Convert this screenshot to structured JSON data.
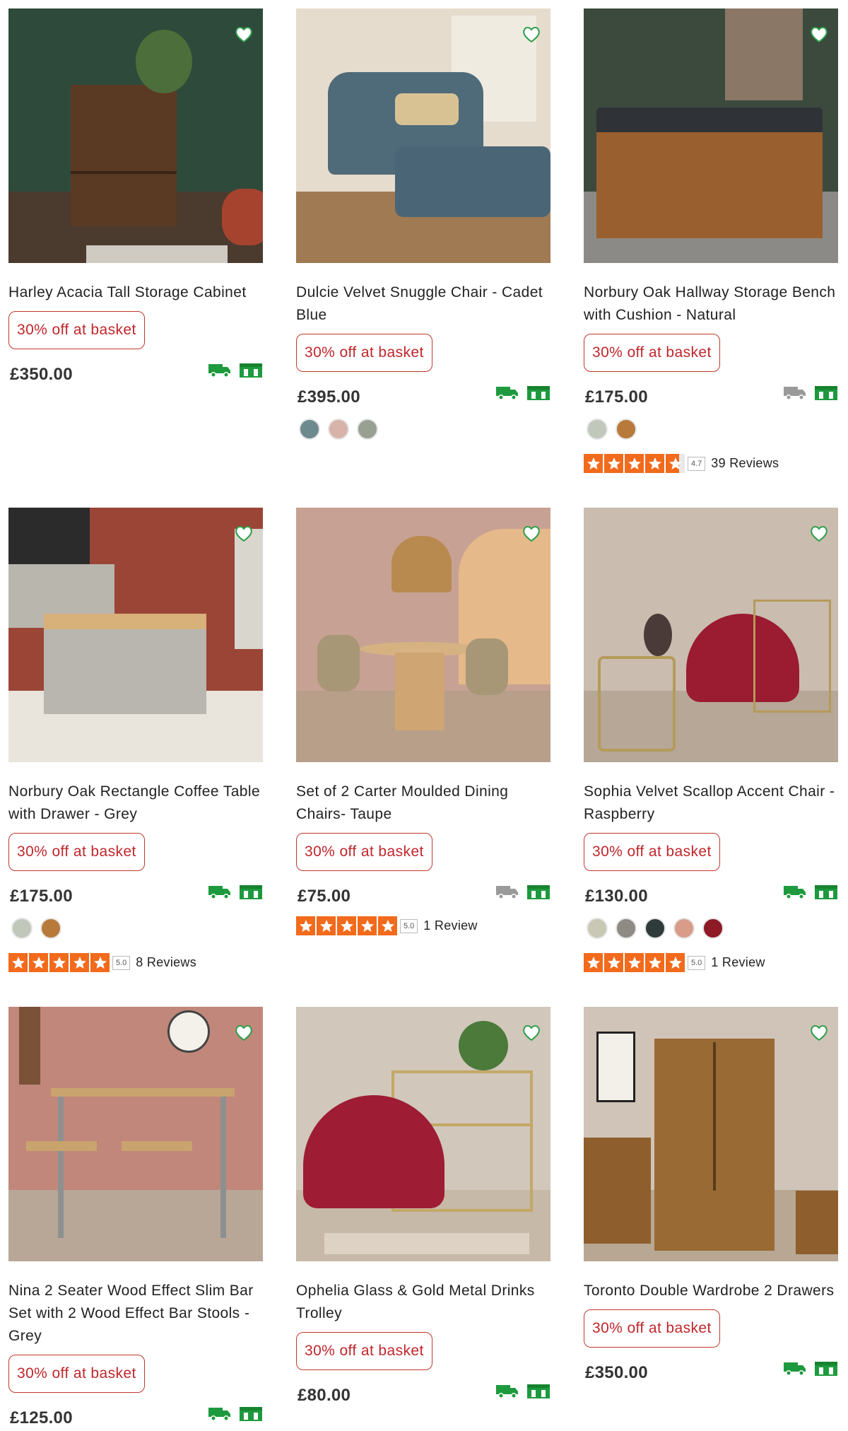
{
  "colors": {
    "offer": "#c0262b",
    "delivery": "#1e9a3e",
    "delivery_muted": "#9a9a9a",
    "star": "#f26a1b",
    "heart": "#2e9e4a"
  },
  "products": [
    {
      "title": "Harley Acacia Tall Storage Cabinet",
      "offer": "30% off at basket",
      "price": "£350.00",
      "delivery_available": true,
      "swatches": [],
      "rating": null
    },
    {
      "title": "Dulcie Velvet Snuggle Chair - Cadet Blue",
      "offer": "30% off at basket",
      "price": "£395.00",
      "delivery_available": true,
      "swatches": [
        "#6d8a8f",
        "#d8b3aa",
        "#98a092"
      ],
      "rating": null
    },
    {
      "title": "Norbury Oak Hallway Storage Bench with Cushion - Natural",
      "offer": "30% off at basket",
      "price": "£175.00",
      "delivery_available": false,
      "swatches": [
        "#bfc8ba",
        "#b87a3a"
      ],
      "rating": {
        "score": "4.7",
        "reviews": "39 Reviews",
        "stars": 4.7
      }
    },
    {
      "title": "Norbury Oak Rectangle Coffee Table with Drawer - Grey",
      "offer": "30% off at basket",
      "price": "£175.00",
      "delivery_available": true,
      "swatches": [
        "#bfc8ba",
        "#b87a3a"
      ],
      "rating": {
        "score": "5.0",
        "reviews": "8 Reviews",
        "stars": 5
      }
    },
    {
      "title": "Set of 2 Carter Moulded Dining Chairs- Taupe",
      "offer": "30% off at basket",
      "price": "£75.00",
      "delivery_available": false,
      "swatches": [],
      "rating": {
        "score": "5.0",
        "reviews": "1 Review",
        "stars": 5
      }
    },
    {
      "title": "Sophia Velvet Scallop Accent Chair - Raspberry",
      "offer": "30% off at basket",
      "price": "£130.00",
      "delivery_available": true,
      "swatches": [
        "#c8c8b4",
        "#8f8a84",
        "#2e3b39",
        "#d99c88",
        "#8e1a26"
      ],
      "rating": {
        "score": "5.0",
        "reviews": "1 Review",
        "stars": 5
      }
    },
    {
      "title": "Nina 2 Seater Wood Effect Slim Bar Set with 2 Wood Effect Bar Stools - Grey",
      "offer": "30% off at basket",
      "price": "£125.00",
      "delivery_available": true,
      "swatches": [],
      "rating": null
    },
    {
      "title": "Ophelia Glass & Gold Metal Drinks Trolley",
      "offer": "30% off at basket",
      "price": "£80.00",
      "delivery_available": true,
      "swatches": [],
      "rating": null
    },
    {
      "title": "Toronto Double Wardrobe 2 Drawers",
      "offer": "30% off at basket",
      "price": "£350.00",
      "delivery_available": true,
      "swatches": [],
      "rating": null
    }
  ]
}
